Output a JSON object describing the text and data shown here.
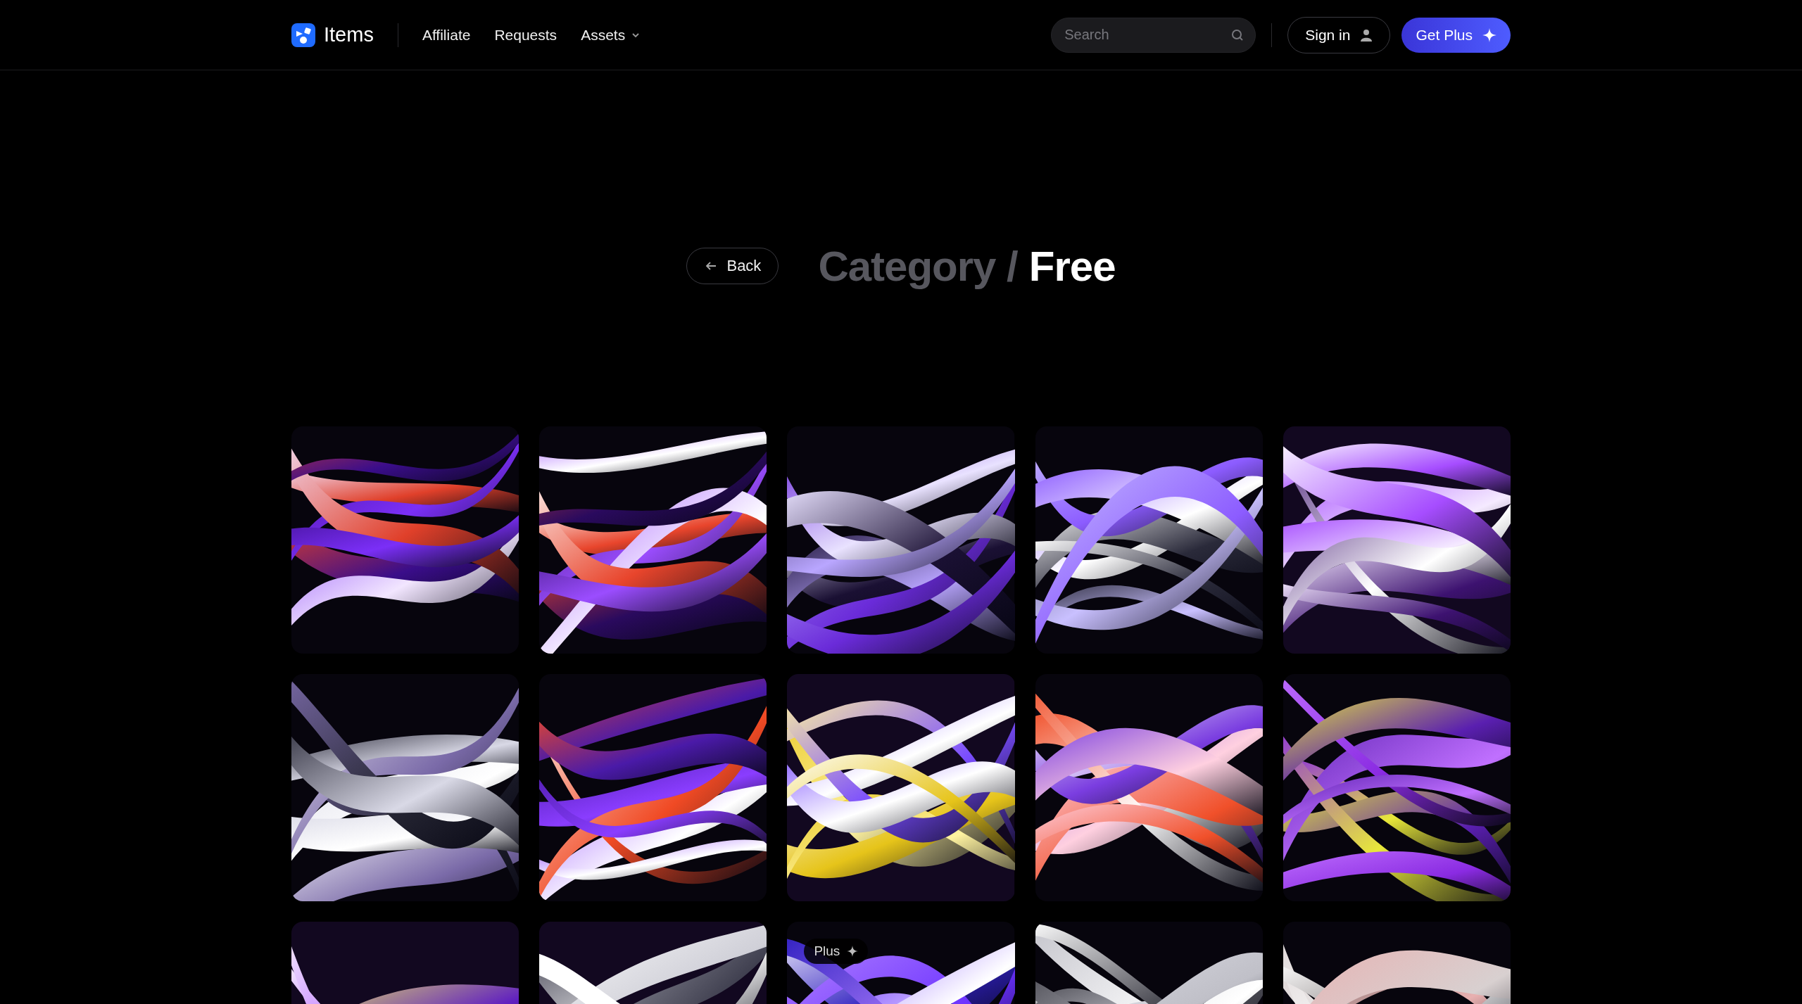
{
  "header": {
    "logo": "Items",
    "nav": [
      {
        "label": "Affiliate",
        "dropdown": false
      },
      {
        "label": "Requests",
        "dropdown": false
      },
      {
        "label": "Assets",
        "dropdown": true
      }
    ],
    "search": {
      "placeholder": "Search"
    },
    "sign_in": "Sign in",
    "get_plus": "Get Plus"
  },
  "back": "Back",
  "title": {
    "category": "Category /",
    "name": "Free"
  },
  "tiles": [
    {
      "kind": "picture"
    },
    {
      "kind": "picture"
    },
    {
      "kind": "picture"
    },
    {
      "kind": "picture"
    },
    {
      "kind": "picture"
    },
    {
      "kind": "picture"
    },
    {
      "kind": "picture"
    },
    {
      "kind": "picture"
    },
    {
      "kind": "picture"
    },
    {
      "kind": "picture"
    },
    {
      "kind": "picture"
    },
    {
      "kind": "picture"
    },
    {
      "kind": "picture",
      "badge": "Plus"
    },
    {
      "kind": "picture"
    },
    {
      "kind": "picture"
    }
  ]
}
